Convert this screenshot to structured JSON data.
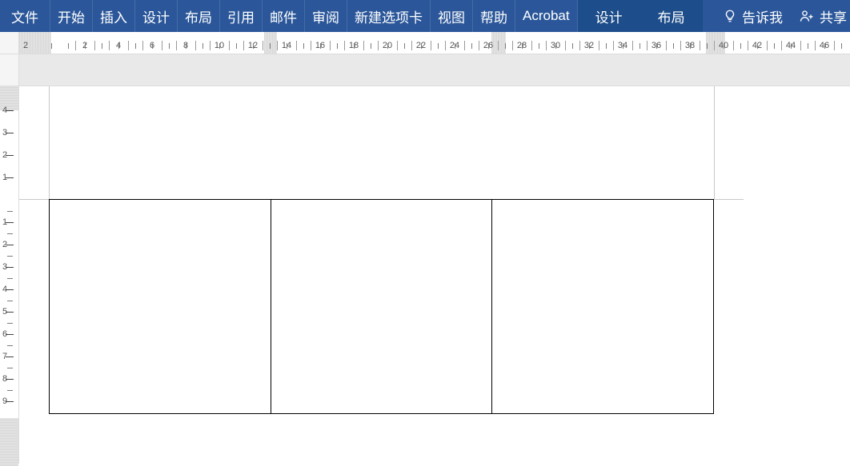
{
  "ribbon": {
    "tabs": [
      {
        "id": "file",
        "label": "文件"
      },
      {
        "id": "home",
        "label": "开始"
      },
      {
        "id": "insert",
        "label": "插入"
      },
      {
        "id": "design",
        "label": "设计"
      },
      {
        "id": "layout",
        "label": "布局"
      },
      {
        "id": "references",
        "label": "引用"
      },
      {
        "id": "mail",
        "label": "邮件"
      },
      {
        "id": "review",
        "label": "审阅"
      },
      {
        "id": "newtab",
        "label": "新建选项卡"
      },
      {
        "id": "view",
        "label": "视图"
      },
      {
        "id": "help",
        "label": "帮助"
      },
      {
        "id": "acrobat",
        "label": "Acrobat"
      }
    ],
    "contextual": [
      {
        "id": "table-design",
        "label": "设计"
      },
      {
        "id": "table-layout",
        "label": "布局"
      }
    ],
    "tell_me": "告诉我",
    "share": "共享"
  },
  "h_ruler": {
    "start_number": 2,
    "numbers": [
      2,
      2,
      4,
      6,
      8,
      10,
      12,
      14,
      16,
      18,
      20,
      22,
      24,
      26,
      28,
      30,
      32,
      34,
      36,
      38,
      40,
      42,
      44,
      46
    ],
    "margin_left_char": 2,
    "margin_right_char": 38
  },
  "v_ruler": {
    "top_numbers": [
      4,
      3,
      2,
      1
    ],
    "body_numbers": [
      1,
      2,
      3,
      4,
      5,
      6,
      7,
      8,
      9
    ]
  },
  "table": {
    "rows": 1,
    "cols": 3,
    "cells": [
      "",
      "",
      ""
    ]
  }
}
